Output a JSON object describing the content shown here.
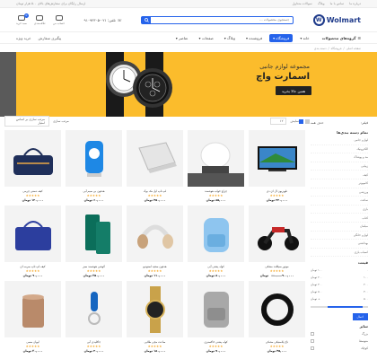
{
  "topbar": {
    "links": [
      "درباره ما",
      "تماس با ما",
      "وبلاگ",
      "سوالات متداول"
    ],
    "promo": "ارسال رایگان برای سفارش‌های بالای ۵۰۰ هزار تومان"
  },
  "header": {
    "logo": "Wolmart",
    "logo_mark": "W",
    "search_placeholder": "جستجوی محصولات ...",
    "phone": "تلفن: ۰۲۱-۹۱۰۹۲۳۰۵",
    "icons": [
      {
        "label": "حساب من",
        "name": "user"
      },
      {
        "label": "علاقه‌مندی",
        "name": "heart"
      },
      {
        "label": "سبد خرید",
        "name": "cart",
        "badge": "0"
      }
    ]
  },
  "nav": {
    "categories_label": "گروه‌های محصولات",
    "links": [
      {
        "label": "خانه",
        "active": false
      },
      {
        "label": "فروشگاه",
        "active": true
      },
      {
        "label": "فروشنده",
        "active": false
      },
      {
        "label": "وبلاگ",
        "active": false
      },
      {
        "label": "صفحات",
        "active": false
      },
      {
        "label": "عناصر",
        "active": false
      }
    ],
    "extra": [
      "پیگیری سفارش",
      "خرید ویژه"
    ]
  },
  "breadcrumb": [
    "صفحه اصلی",
    "فروشگاه",
    "دسته بندی"
  ],
  "banner": {
    "line1": "مجموعه لوازم جانبی",
    "line2": "اسمارت واچ",
    "cta": "همین حالا بخرید"
  },
  "sidebar": {
    "filter_label": "فیلتر:",
    "clear_label": "حذف همه",
    "categories_title": "تمام دسته بندی‌ها",
    "categories": [
      "لوازم جانبی",
      "الکترونیک",
      "مد و پوشاک",
      "زیبایی",
      "کیف",
      "کامپیوتر",
      "ورزشی",
      "ساعت",
      "بازی",
      "کتاب",
      "مبلمان",
      "لوازم خانگی",
      "بهداشتی",
      "اسباب بازی"
    ],
    "price_title": "قیمت",
    "prices": [
      {
        "from": "۰",
        "to": "۱۰۰ تومان"
      },
      {
        "from": "۱۰۰",
        "to": "۲۰۰ تومان"
      },
      {
        "from": "۲۰۰",
        "to": "۳۰۰ تومان"
      },
      {
        "from": "۳۰۰",
        "to": "۵۰۰ تومان"
      },
      {
        "from": "۵۰۰",
        "to": "+ تومان"
      }
    ],
    "apply_label": "اعمال",
    "size_title": "سایز",
    "sizes": [
      "بزرگ",
      "متوسط",
      "کوچک"
    ]
  },
  "toolbar": {
    "sort_label": "مرتب سازی",
    "sort_value": "مرتب سازی بر اساس امتیاز",
    "per_label": "نمایش",
    "per_value": "۱۲"
  },
  "products": [
    {
      "name": "تلویزیون ال ای دی",
      "price": "۲۲۰,۰۰۰ تومان",
      "old": "",
      "kind": "tv"
    },
    {
      "name": "چراغ خواب هوشمند",
      "price": "۸۵,۰۰۰ تومان",
      "old": "",
      "kind": "lamp"
    },
    {
      "name": "لپ تاپ اپل مک بوک",
      "price": "۴۵۰,۰۰۰ تومان",
      "old": "",
      "kind": "laptop"
    },
    {
      "name": "هدفون بی سیم آبی",
      "price": "۶۰,۰۰۰ تومان",
      "old": "",
      "kind": "speaker"
    },
    {
      "name": "کیف دستی چرمی",
      "price": "۱۲۰,۰۰۰ تومان",
      "old": "",
      "kind": "bag"
    },
    {
      "name": "موتور سیکلت مشکی",
      "price": "۹۰۰,۰۰۰ تومان",
      "old": "۹۵۰,۰۰۰",
      "kind": "moto"
    },
    {
      "name": "کوله پشتی آبی",
      "price": "۸۰,۰۰۰ تومان",
      "old": "",
      "kind": "backpack"
    },
    {
      "name": "هدفون سفید استودیو",
      "price": "۱۱۰,۰۰۰ تومان",
      "old": "",
      "kind": "headphone"
    },
    {
      "name": "گوشی هوشمند سبز",
      "price": "۳۵۰,۰۰۰ تومان",
      "old": "",
      "kind": "phone"
    },
    {
      "name": "کیف لپ تاپ سرمه ای",
      "price": "۹۰,۰۰۰ تومان",
      "old": "",
      "kind": "laptopbag"
    },
    {
      "name": "تاج پلاستیکی مشکی",
      "price": "۴۵,۰۰۰ تومان",
      "old": "",
      "kind": "ring"
    },
    {
      "name": "کوله پشتی خاکستری",
      "price": "۷۰,۰۰۰ تومان",
      "old": "",
      "kind": "graybag"
    },
    {
      "name": "ساعت مچی طلایی",
      "price": "۱۸۰,۰۰۰ تومان",
      "old": "",
      "kind": "watch"
    },
    {
      "name": "جاکلیدی آبی",
      "price": "۲۰,۰۰۰ تومان",
      "old": "",
      "kind": "keychain"
    },
    {
      "name": "لیوان مسی",
      "price": "۳۰,۰۰۰ تومان",
      "old": "",
      "kind": "cup"
    }
  ],
  "rating": "★★★★★"
}
